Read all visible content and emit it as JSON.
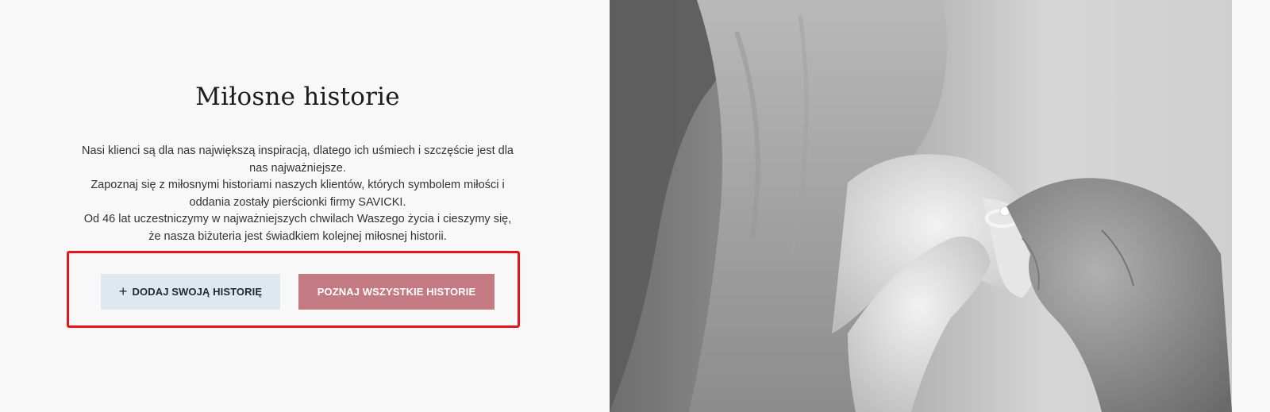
{
  "section": {
    "title": "Miłosne historie",
    "description": [
      "Nasi klienci są dla nas największą inspiracją, dlatego ich uśmiech i szczęście jest dla nas najważniejsze.",
      "Zapoznaj się z miłosnymi historiami naszych klientów, których symbolem miłości i oddania zostały pierścionki firmy SAVICKI.",
      "Od 46 lat uczestniczymy w najważniejszych chwilach Waszego życia i cieszymy się, że nasza biżuteria jest świadkiem kolejnej miłosnej historii."
    ]
  },
  "buttons": {
    "add_icon": "plus-icon",
    "add_label": "DODAJ SWOJĄ HISTORIĘ",
    "all_label": "POZNAJ WSZYSTKIE HISTORIE"
  },
  "colors": {
    "add_button_bg": "#dde8f1",
    "all_button_bg": "#c47a82",
    "highlight_border": "#e8141c"
  }
}
